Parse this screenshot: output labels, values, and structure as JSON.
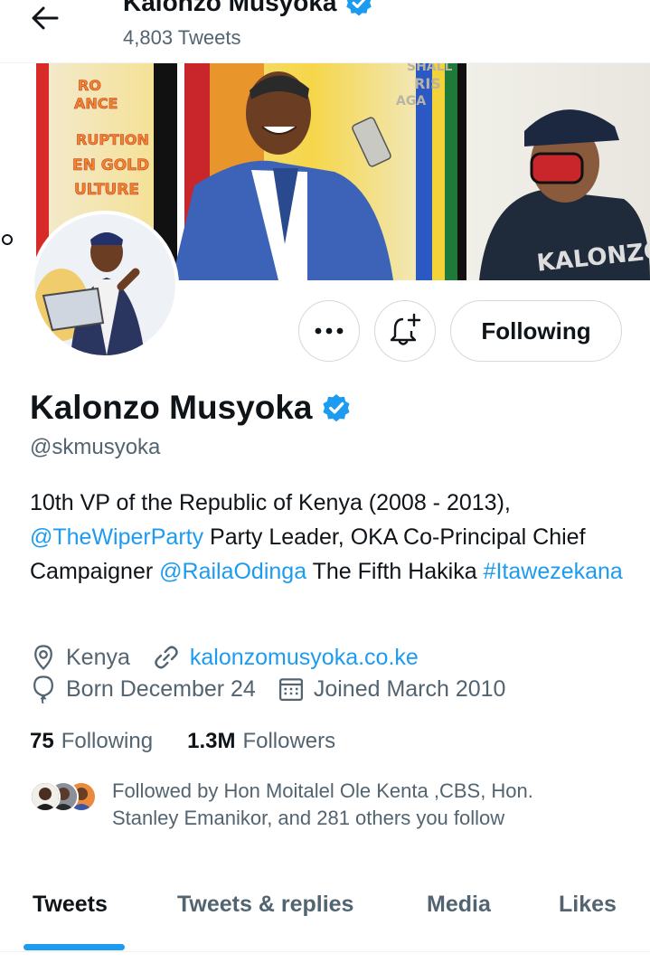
{
  "header": {
    "name": "Kalonzo Musyoka",
    "tweet_count": "4,803 Tweets",
    "back_icon": "arrow-left-icon"
  },
  "profile": {
    "name": "Kalonzo Musyoka",
    "handle": "@skmusyoka",
    "verified": true,
    "bio_line1": "10th VP of the Republic of Kenya (2008 - 2013),",
    "bio_mention1": "@TheWiperParty",
    "bio_text2": " Party Leader, OKA Co-Principal Chief Campaigner ",
    "bio_mention2": "@RailaOdinga",
    "bio_text3": " The Fifth Hakika ",
    "bio_hashtag": "#Itawezekana",
    "location": "Kenya",
    "website": "kalonzomusyoka.co.ke",
    "birthday": "Born December 24",
    "joined": "Joined March 2010"
  },
  "banner": {
    "mural_text_left": [
      "RO",
      "ANCE",
      "RUPTION",
      "EN GOLD",
      "ULTURE"
    ],
    "mural_text_right": "KALONZO",
    "mural_text_top": [
      "SHALL",
      "RIS",
      "AGA"
    ]
  },
  "actions": {
    "more_icon": "more-icon",
    "notify_icon": "bell-plus-icon",
    "following_label": "Following"
  },
  "stats": {
    "following_count": "75",
    "following_label": "Following",
    "followers_count": "1.3M",
    "followers_label": "Followers"
  },
  "followed_by": {
    "text": "Followed by Hon Moitalel Ole Kenta ,CBS, Hon. Stanley Emanikor, and 281 others you follow"
  },
  "tabs": [
    {
      "label": "Tweets",
      "active": true
    },
    {
      "label": "Tweets & replies",
      "active": false
    },
    {
      "label": "Media",
      "active": false
    },
    {
      "label": "Likes",
      "active": false
    }
  ],
  "colors": {
    "accent": "#1d9bf0",
    "text": "#0f1419",
    "secondary": "#536471"
  }
}
